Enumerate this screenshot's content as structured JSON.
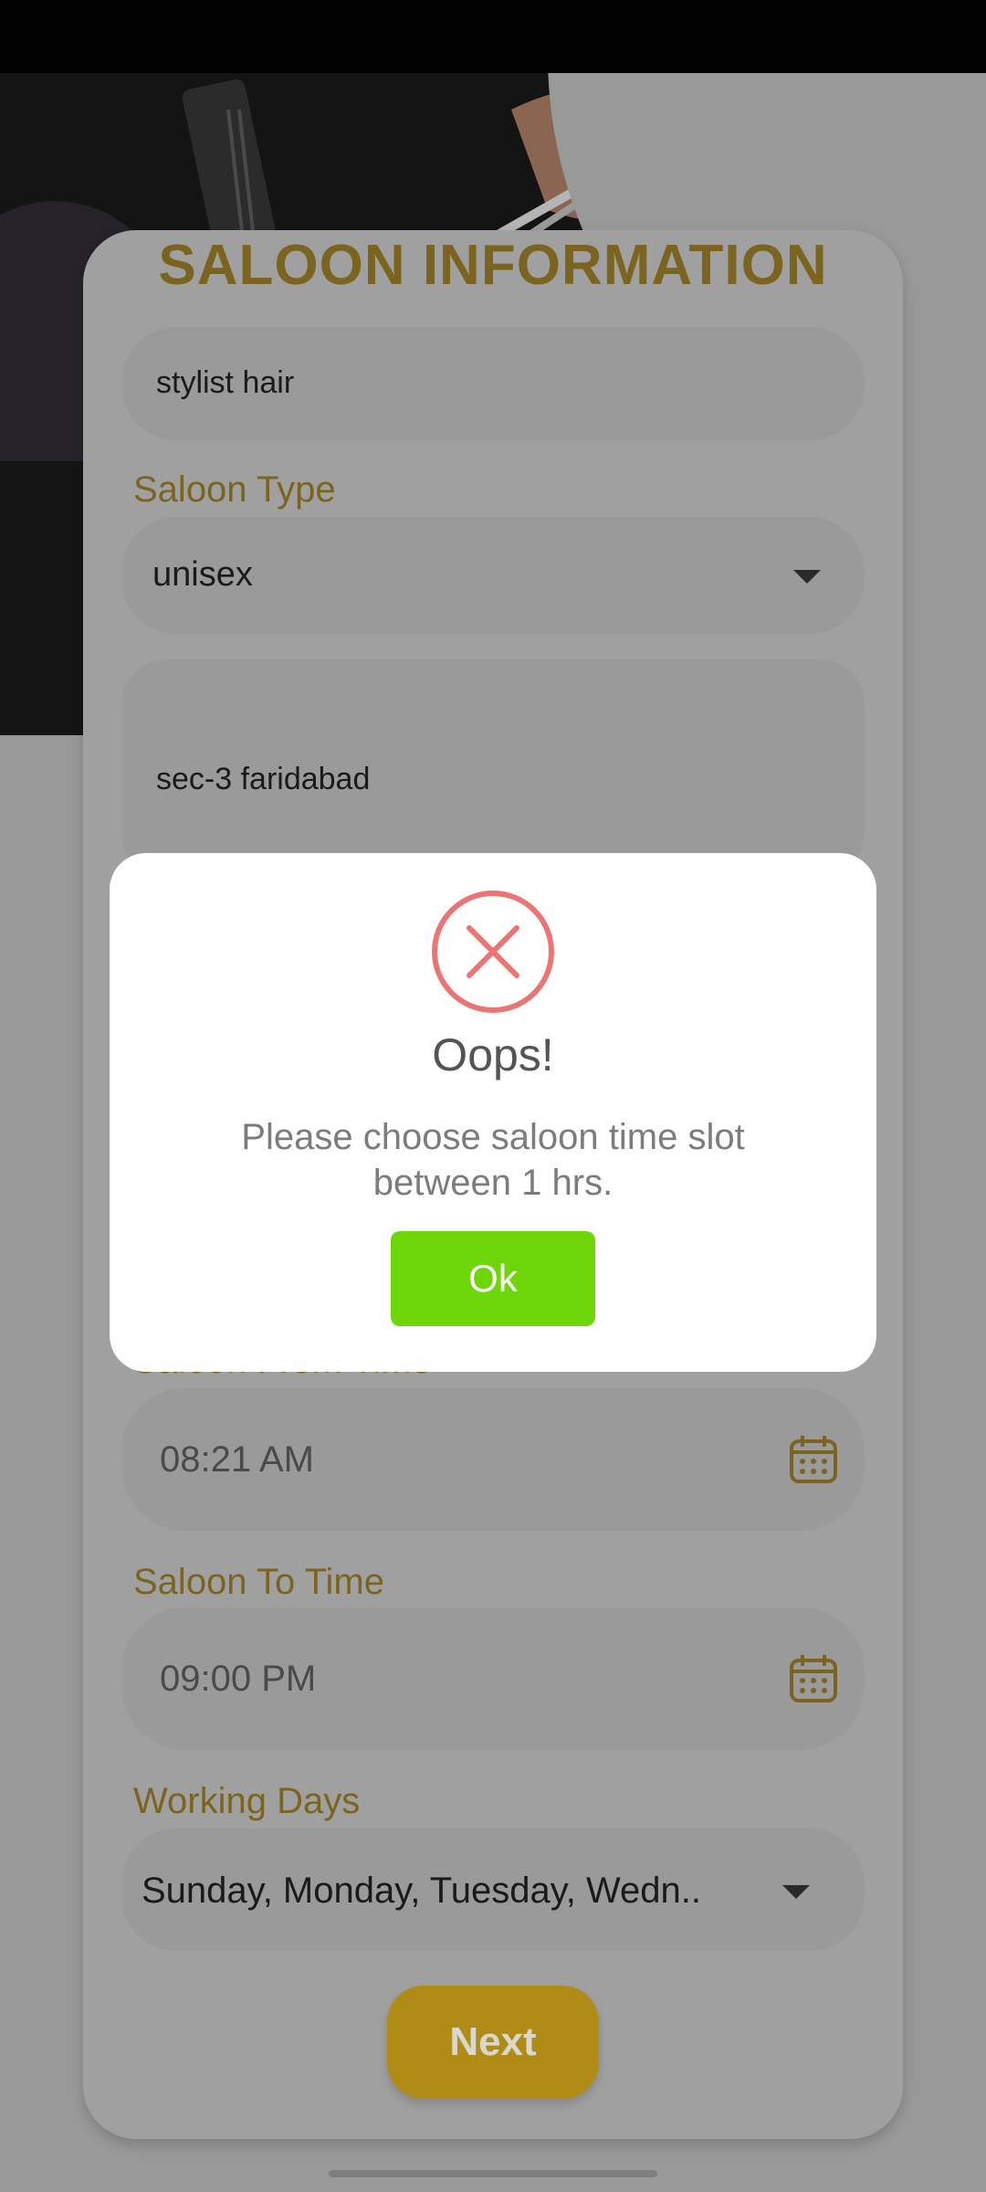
{
  "form": {
    "title": "SALOON INFORMATION",
    "saloon_name_value": "stylist hair",
    "saloon_type_label": "Saloon Type",
    "saloon_type_value": "unisex",
    "address_value": "sec-3 faridabad",
    "from_time_label": "Saloon From Time",
    "from_time_value": "08:21 AM",
    "to_time_label": "Saloon To Time",
    "to_time_value": "09:00 PM",
    "working_days_label": "Working Days",
    "working_days_value": "Sunday, Monday, Tuesday, Wedn..",
    "next_label": "Next"
  },
  "dialog": {
    "title": "Oops!",
    "message": "Please choose saloon time slot between 1 hrs.",
    "ok_label": "Ok",
    "icon": "error-x-circle-icon",
    "icon_color": "#ec7474",
    "ok_color": "#6ed608"
  },
  "colors": {
    "accent_gold": "#7a6420",
    "next_button": "#b08c16"
  }
}
